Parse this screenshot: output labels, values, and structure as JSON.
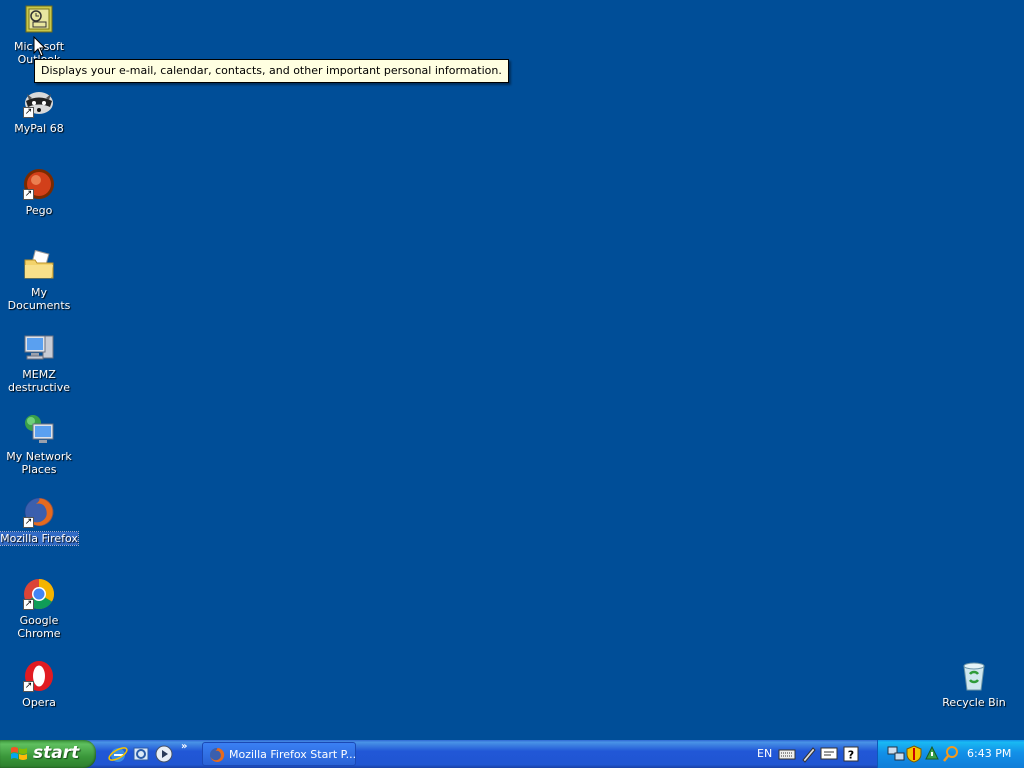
{
  "desktop": {
    "icons": [
      {
        "label": "Microsoft Outlook",
        "icon": "outlook-icon"
      },
      {
        "label": "MyPal 68",
        "icon": "mypal-icon"
      },
      {
        "label": "Pego",
        "icon": "pego-icon"
      },
      {
        "label": "My Documents",
        "icon": "folder-icon"
      },
      {
        "label": "MEMZ destructive",
        "icon": "computer-icon"
      },
      {
        "label": "My Network Places",
        "icon": "network-icon"
      },
      {
        "label": "Mozilla Firefox",
        "icon": "firefox-icon"
      },
      {
        "label": "Google Chrome",
        "icon": "chrome-icon"
      },
      {
        "label": "Opera",
        "icon": "opera-icon"
      },
      {
        "label": "Recycle Bin",
        "icon": "recycle-bin-icon"
      }
    ],
    "tooltip": "Displays your e-mail, calendar, contacts, and other important personal information.",
    "background_color": "#004e98"
  },
  "taskbar": {
    "start_label": "start",
    "quick_launch": [
      "ie-icon",
      "outlook-express-icon",
      "media-player-icon"
    ],
    "chevron": "»",
    "tasks": [
      {
        "title": "Mozilla Firefox Start P...",
        "icon": "firefox-icon"
      }
    ],
    "language": "EN",
    "toolbar_icons": [
      "keyboard-icon",
      "pen-icon",
      "text-services-icon",
      "help-icon"
    ],
    "tray_icons": [
      "network-tray-icon",
      "security-shield-icon",
      "update-icon",
      "search-tray-icon"
    ],
    "clock": "6:43 PM"
  }
}
